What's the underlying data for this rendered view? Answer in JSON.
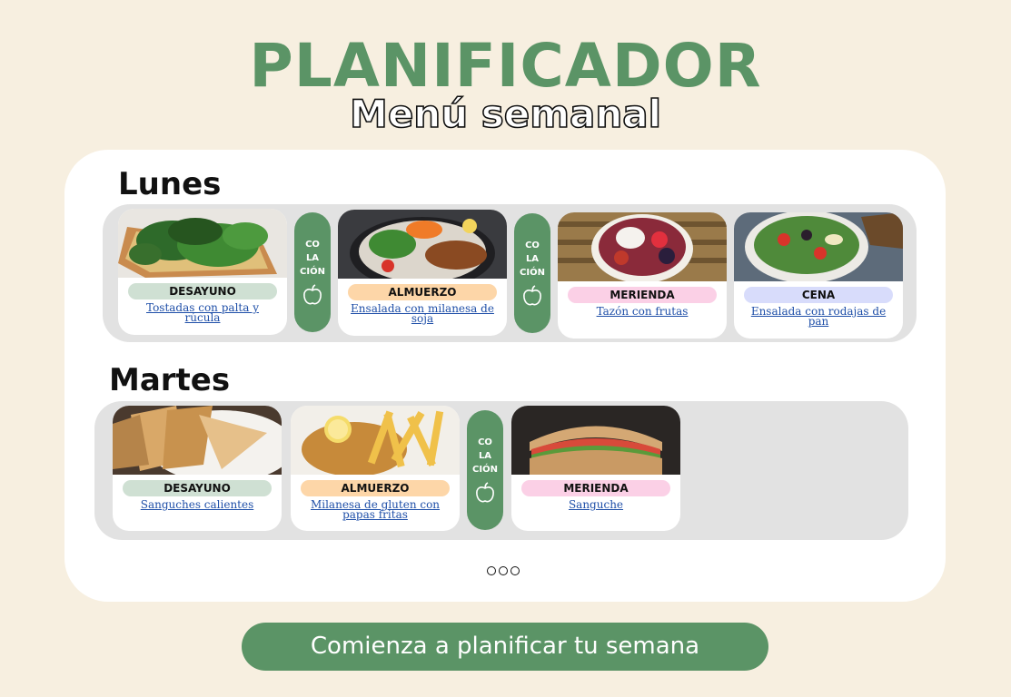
{
  "header": {
    "title": "PLANIFICADOR",
    "subtitle": "Menú semanal"
  },
  "days": [
    {
      "name": "Lunes",
      "meals": [
        {
          "tag": "DESAYUNO",
          "dish": "Tostadas con palta y rúcula"
        },
        {
          "snack": "CO LA CIÓN"
        },
        {
          "tag": "ALMUERZO",
          "dish": "Ensalada con milanesa de soja"
        },
        {
          "snack": "CO LA CIÓN"
        },
        {
          "tag": "MERIENDA",
          "dish": "Tazón con frutas"
        },
        {
          "tag": "CENA",
          "dish": "Ensalada con rodajas de pan"
        }
      ]
    },
    {
      "name": "Martes",
      "meals": [
        {
          "tag": "DESAYUNO",
          "dish": "Sanguches calientes"
        },
        {
          "tag": "ALMUERZO",
          "dish": "Milanesa de gluten con papas fritas"
        },
        {
          "snack": "CO LA CIÓN"
        },
        {
          "tag": "MERIENDA",
          "dish": "Sanguche"
        }
      ]
    }
  ],
  "snack_lines": [
    "CO",
    "LA",
    "CIÓN"
  ],
  "more_indicator": "three dots",
  "cta_label": "Comienza a planificar tu semana",
  "colors": {
    "background": "#f7efe0",
    "brand_green": "#5b9466",
    "desayuno": "#cfe0d3",
    "almuerzo": "#fdd6a8",
    "merienda": "#fbd0e6",
    "cena": "#d8dcfb",
    "link": "#1f4fa8"
  },
  "icons": {
    "snack_icon": "apple-icon"
  }
}
